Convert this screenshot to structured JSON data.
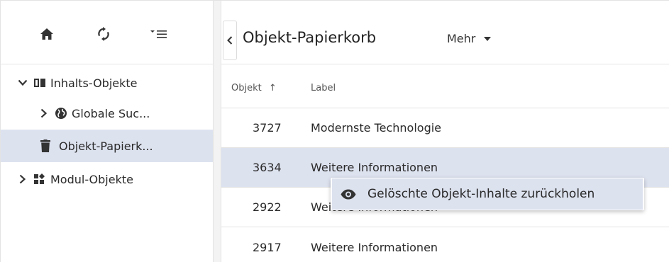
{
  "sidebar": {
    "toolbar": {
      "home_icon": "home-icon",
      "refresh_icon": "refresh-icon",
      "filter_icon": "filter-list-icon"
    },
    "tree": [
      {
        "label": "Inhalts-Objekte",
        "expanded": true,
        "icon": "book-icon",
        "level": 0
      },
      {
        "label": "Globale Suc...",
        "expanded": false,
        "icon": "globe-icon",
        "level": 1
      },
      {
        "label": "Objekt-Papierk...",
        "selected": true,
        "icon": "trash-icon",
        "level": 1
      },
      {
        "label": "Modul-Objekte",
        "expanded": false,
        "icon": "modules-icon",
        "level": 0
      }
    ]
  },
  "main": {
    "title": "Objekt-Papierkorb",
    "more_label": "Mehr",
    "table": {
      "columns": {
        "object": "Objekt",
        "label": "Label"
      },
      "sort_indicator": "↑",
      "rows": [
        {
          "id": "3727",
          "label": "Modernste Technologie"
        },
        {
          "id": "3634",
          "label": "Weitere Informationen",
          "selected": true
        },
        {
          "id": "2922",
          "label": "Weitere Informationen"
        },
        {
          "id": "2917",
          "label": "Weitere Informationen"
        }
      ]
    }
  },
  "context_menu": {
    "items": [
      {
        "label": "Gelöschte Objekt-Inhalte zurückholen",
        "icon": "eye-icon"
      }
    ]
  },
  "colors": {
    "selection": "#dde2ef",
    "border": "#e3e3e3",
    "text": "#2a2a2a"
  }
}
